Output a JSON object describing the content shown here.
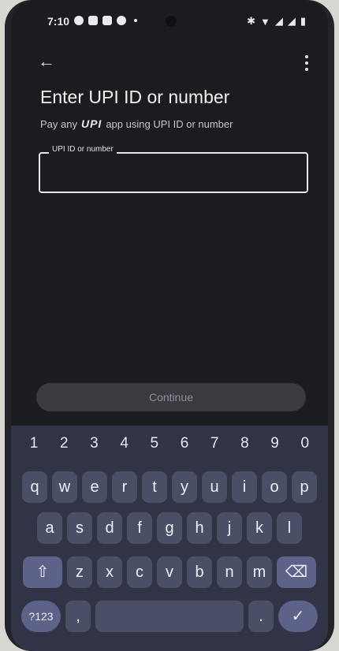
{
  "status_bar": {
    "time": "7:10",
    "battery_label": "▮"
  },
  "header": {
    "back_icon": "←",
    "title": "Enter UPI ID or number",
    "subtitle_prefix": "Pay any",
    "upi_logo": "UPI",
    "subtitle_suffix": "app using UPI ID or number"
  },
  "form": {
    "field_label": "UPI ID or number",
    "field_value": "",
    "continue_label": "Continue"
  },
  "keyboard": {
    "numbers": [
      "1",
      "2",
      "3",
      "4",
      "5",
      "6",
      "7",
      "8",
      "9",
      "0"
    ],
    "row1": [
      "q",
      "w",
      "e",
      "r",
      "t",
      "y",
      "u",
      "i",
      "o",
      "p"
    ],
    "row2": [
      "a",
      "s",
      "d",
      "f",
      "g",
      "h",
      "j",
      "k",
      "l"
    ],
    "row3": [
      "z",
      "x",
      "c",
      "v",
      "b",
      "n",
      "m"
    ],
    "shift_icon": "⇧",
    "backspace_icon": "⌫",
    "symbols_label": "?123",
    "comma": ",",
    "period": ".",
    "done_icon": "✓"
  }
}
